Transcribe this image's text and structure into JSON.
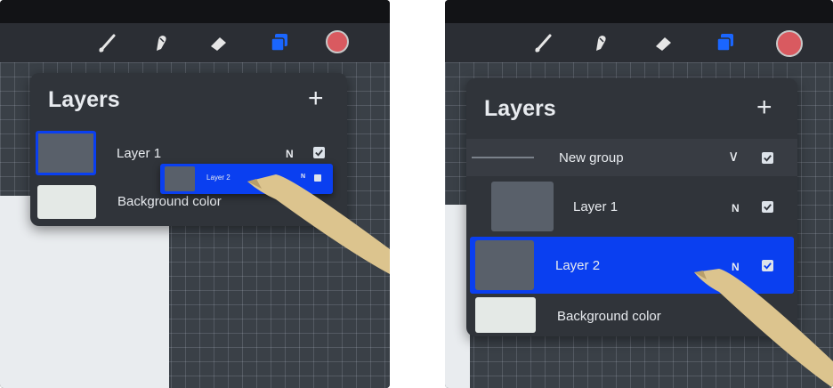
{
  "left": {
    "panel": {
      "title": "Layers",
      "add_symbol": "+"
    },
    "layers": [
      {
        "name": "Layer 1",
        "blend": "N",
        "visible": true,
        "selected": true
      },
      {
        "name": "Background color",
        "blend": "",
        "visible": true,
        "selected": false
      }
    ],
    "dragging_layer": {
      "name": "Layer 2",
      "blend": "N",
      "visible": true
    }
  },
  "right": {
    "panel": {
      "title": "Layers",
      "add_symbol": "+"
    },
    "group": {
      "name": "New group",
      "expand_symbol": "∨",
      "visible": true
    },
    "layers": [
      {
        "name": "Layer 1",
        "blend": "N",
        "visible": true,
        "selected": false
      },
      {
        "name": "Layer 2",
        "blend": "N",
        "visible": true,
        "selected": true
      },
      {
        "name": "Background color",
        "blend": "",
        "visible": true,
        "selected": false
      }
    ]
  },
  "toolbar_icons": [
    "brush-icon",
    "smudge-icon",
    "eraser-icon",
    "layers-icon",
    "color-swatch"
  ],
  "colors": {
    "selection_blue": "#0a3ff0",
    "panel_bg": "#30343a",
    "active_color": "#d95a60",
    "layers_icon_blue": "#1a66ff"
  }
}
